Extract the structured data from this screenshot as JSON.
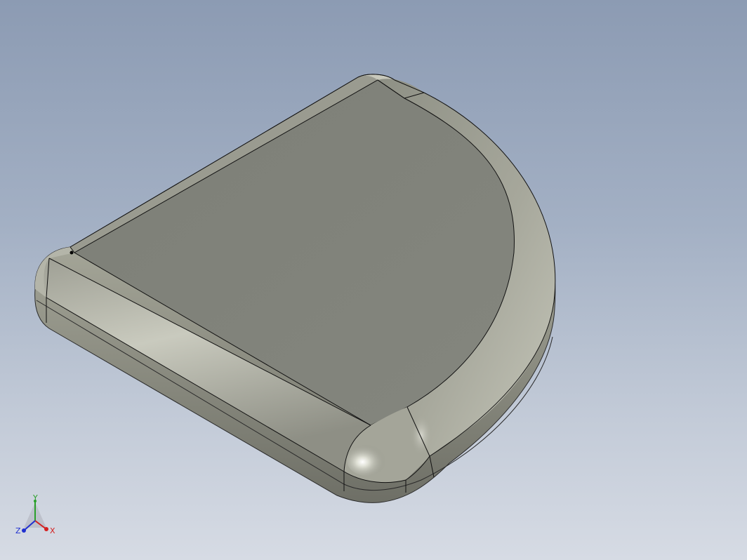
{
  "viewport": {
    "background_top": "#8c9bb3",
    "background_bottom": "#d6dbe4"
  },
  "part": {
    "name": "rounded-quarter-disc-part",
    "face_color": "#82847c",
    "edge_color": "#1a1a1a"
  },
  "triad": {
    "x_label": "X",
    "y_label": "Y",
    "z_label": "Z",
    "x_color": "#d42020",
    "y_color": "#2aa02a",
    "z_color": "#2030d0"
  }
}
